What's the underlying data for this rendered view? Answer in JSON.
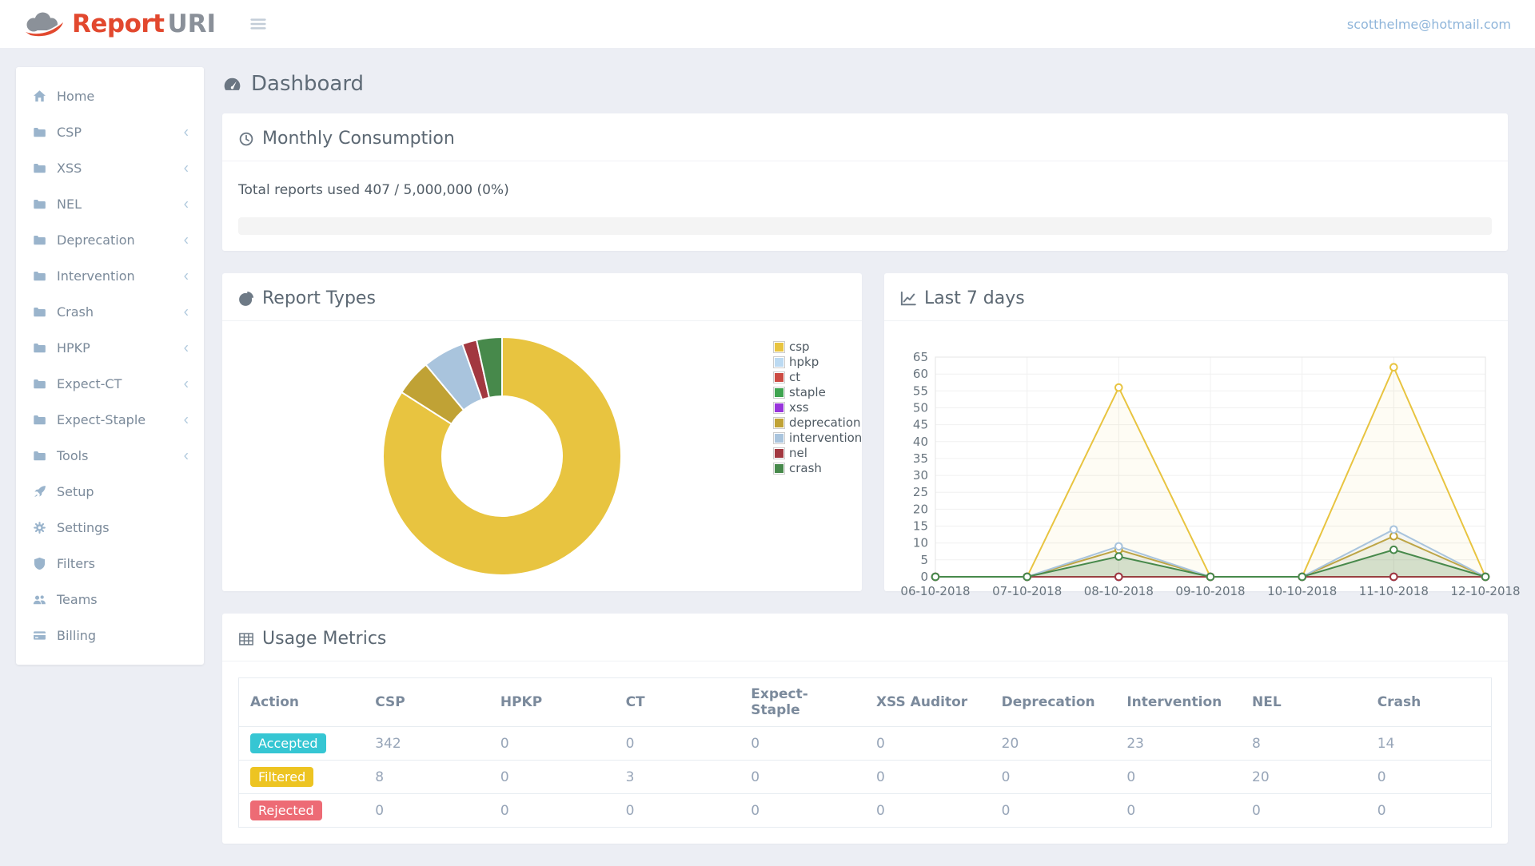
{
  "header": {
    "logo_report": "Report",
    "logo_uri": "URI",
    "user_email": "scotthelme@hotmail.com",
    "menu_icon": "bars-icon",
    "logo_icon": "cloud-logo-icon"
  },
  "sidebar": {
    "items": [
      {
        "label": "Home",
        "icon": "home-icon",
        "expandable": false
      },
      {
        "label": "CSP",
        "icon": "folder-icon",
        "expandable": true
      },
      {
        "label": "XSS",
        "icon": "folder-icon",
        "expandable": true
      },
      {
        "label": "NEL",
        "icon": "folder-icon",
        "expandable": true
      },
      {
        "label": "Deprecation",
        "icon": "folder-icon",
        "expandable": true
      },
      {
        "label": "Intervention",
        "icon": "folder-icon",
        "expandable": true
      },
      {
        "label": "Crash",
        "icon": "folder-icon",
        "expandable": true
      },
      {
        "label": "HPKP",
        "icon": "folder-icon",
        "expandable": true
      },
      {
        "label": "Expect-CT",
        "icon": "folder-icon",
        "expandable": true
      },
      {
        "label": "Expect-Staple",
        "icon": "folder-icon",
        "expandable": true
      },
      {
        "label": "Tools",
        "icon": "folder-icon",
        "expandable": true
      },
      {
        "label": "Setup",
        "icon": "rocket-icon",
        "expandable": false
      },
      {
        "label": "Settings",
        "icon": "gear-icon",
        "expandable": false
      },
      {
        "label": "Filters",
        "icon": "shield-icon",
        "expandable": false
      },
      {
        "label": "Teams",
        "icon": "users-icon",
        "expandable": false
      },
      {
        "label": "Billing",
        "icon": "credit-card-icon",
        "expandable": false
      }
    ]
  },
  "page": {
    "title": "Dashboard",
    "icon": "tachometer-icon"
  },
  "monthly_consumption": {
    "title": "Monthly Consumption",
    "icon": "clock-icon",
    "usage_text": "Total reports used 407 / 5,000,000 (0%)",
    "progress_percent": 0,
    "progress_color": "#32c5d2"
  },
  "report_types": {
    "title": "Report Types",
    "icon": "pie-chart-icon"
  },
  "last7days": {
    "title": "Last 7 days",
    "icon": "line-chart-icon"
  },
  "usage_metrics": {
    "title": "Usage Metrics",
    "icon": "table-icon",
    "columns": [
      "Action",
      "CSP",
      "HPKP",
      "CT",
      "Expect-Staple",
      "XSS Auditor",
      "Deprecation",
      "Intervention",
      "NEL",
      "Crash"
    ],
    "rows": [
      {
        "action": "Accepted",
        "badge_color": "#36c6d3",
        "values": [
          342,
          0,
          0,
          0,
          0,
          20,
          23,
          8,
          14
        ]
      },
      {
        "action": "Filtered",
        "badge_color": "#edc422",
        "values": [
          8,
          0,
          3,
          0,
          0,
          0,
          0,
          20,
          0
        ]
      },
      {
        "action": "Rejected",
        "badge_color": "#ed6b75",
        "values": [
          0,
          0,
          0,
          0,
          0,
          0,
          0,
          0,
          0
        ]
      }
    ]
  },
  "chart_data": [
    {
      "type": "pie",
      "donut": true,
      "title": "Report Types",
      "labels": [
        "csp",
        "hpkp",
        "ct",
        "staple",
        "xss",
        "deprecation",
        "intervention",
        "nel",
        "crash"
      ],
      "values": [
        342,
        0,
        0,
        0,
        0,
        20,
        23,
        8,
        14
      ],
      "colors": [
        "#e8c440",
        "#bcdaf2",
        "#cc4b43",
        "#3fa450",
        "#9834db",
        "#c0a235",
        "#a9c4dd",
        "#a23840",
        "#47894b"
      ],
      "legend_position": "right"
    },
    {
      "type": "line",
      "title": "Last 7 days",
      "x": [
        "06-10-2018",
        "07-10-2018",
        "08-10-2018",
        "09-10-2018",
        "10-10-2018",
        "11-10-2018",
        "12-10-2018"
      ],
      "ylim": [
        0,
        65
      ],
      "ytick_step": 5,
      "grid": true,
      "series": [
        {
          "name": "csp",
          "color": "#e8c440",
          "fill_opacity": 0.06,
          "values": [
            0,
            0,
            56,
            0,
            0,
            62,
            0
          ]
        },
        {
          "name": "hpkp",
          "color": "#bcdaf2",
          "fill_opacity": 0,
          "values": [
            0,
            0,
            0,
            0,
            0,
            0,
            0
          ]
        },
        {
          "name": "ct",
          "color": "#cc4b43",
          "fill_opacity": 0,
          "values": [
            0,
            0,
            0,
            0,
            0,
            0,
            0
          ]
        },
        {
          "name": "staple",
          "color": "#3fa450",
          "fill_opacity": 0,
          "values": [
            0,
            0,
            0,
            0,
            0,
            0,
            0
          ]
        },
        {
          "name": "xss",
          "color": "#9834db",
          "fill_opacity": 0,
          "values": [
            0,
            0,
            0,
            0,
            0,
            0,
            0
          ]
        },
        {
          "name": "deprecation",
          "color": "#c0a235",
          "fill_opacity": 0.08,
          "values": [
            0,
            0,
            8,
            0,
            0,
            12,
            0
          ]
        },
        {
          "name": "intervention",
          "color": "#a9c4dd",
          "fill_opacity": 0.1,
          "values": [
            0,
            0,
            9,
            0,
            0,
            14,
            0
          ]
        },
        {
          "name": "nel",
          "color": "#a23840",
          "fill_opacity": 0.25,
          "values": [
            0,
            0,
            0,
            0,
            0,
            0,
            0
          ]
        },
        {
          "name": "crash",
          "color": "#47894b",
          "fill_opacity": 0.16,
          "values": [
            0,
            0,
            6,
            0,
            0,
            8,
            0
          ]
        }
      ]
    }
  ]
}
